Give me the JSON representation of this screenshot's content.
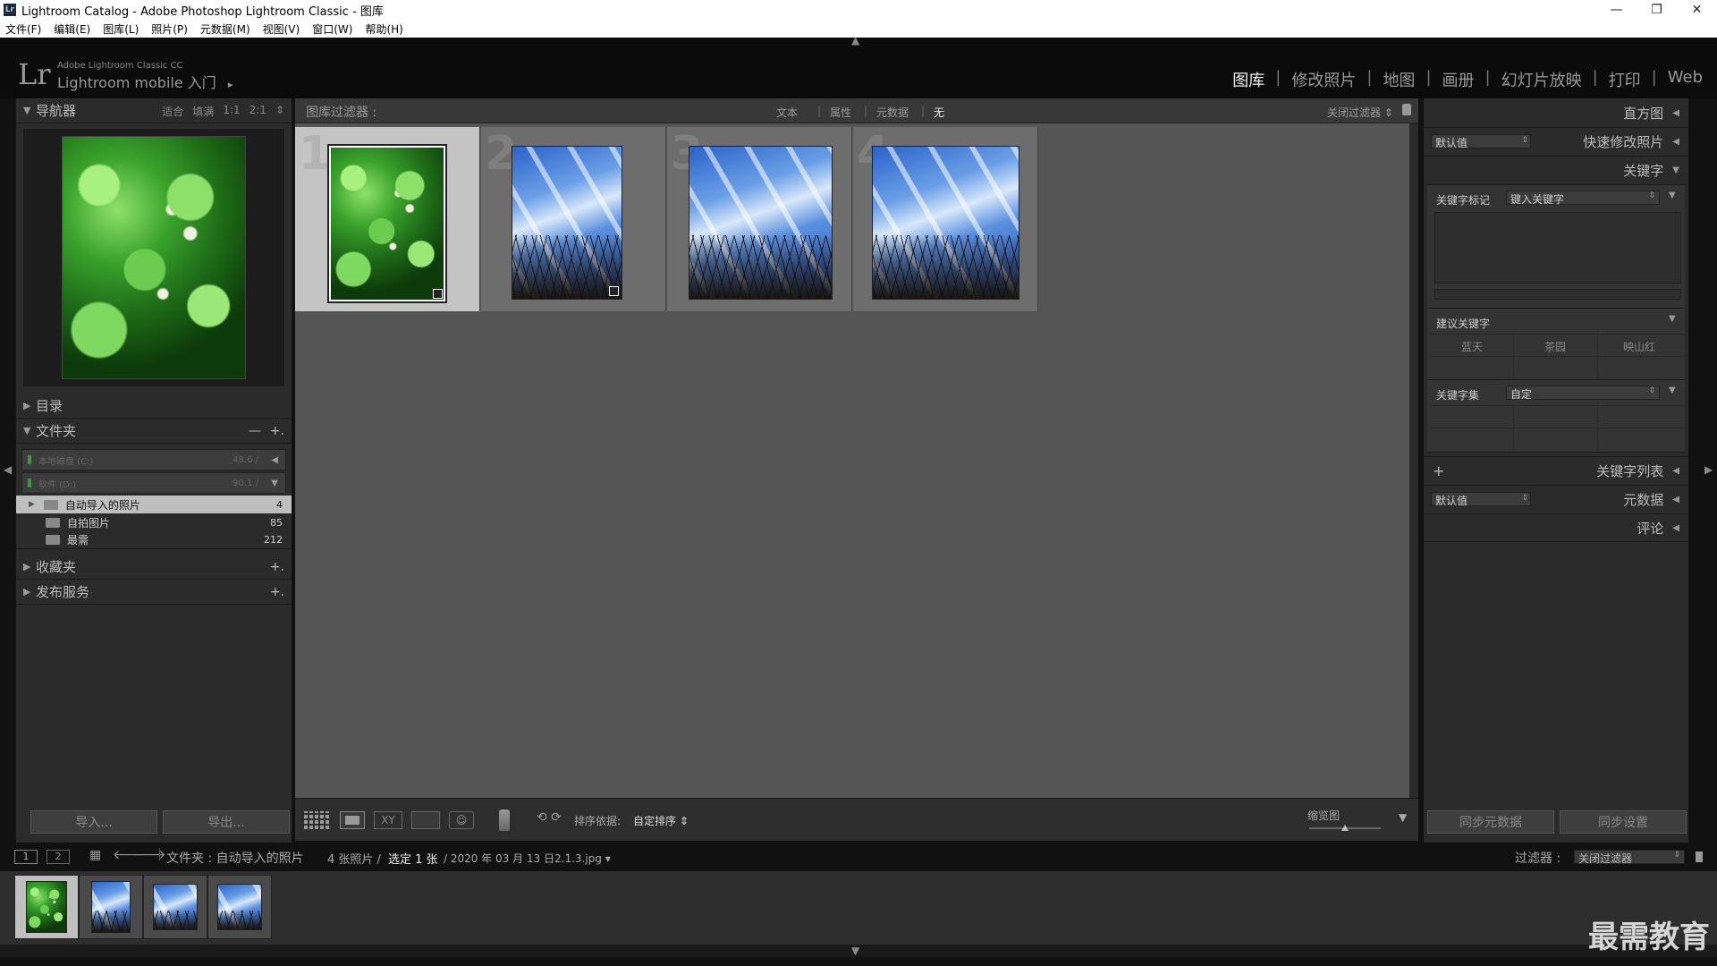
{
  "window": {
    "title": "Lightroom Catalog - Adobe Photoshop Lightroom Classic - 图库",
    "app_badge": "Lr",
    "controls": [
      "—",
      "❐",
      "✕"
    ]
  },
  "menu": [
    "文件(F)",
    "编辑(E)",
    "图库(L)",
    "照片(P)",
    "元数据(M)",
    "视图(V)",
    "窗口(W)",
    "帮助(H)"
  ],
  "identity": {
    "logo": "Lr",
    "line1": "Adobe Lightroom Classic CC",
    "line2": "Lightroom mobile 入门",
    "arrow": "▸"
  },
  "modules": {
    "items": [
      "图库",
      "修改照片",
      "地图",
      "画册",
      "幻灯片放映",
      "打印",
      "Web"
    ],
    "active": "图库",
    "sep": "|"
  },
  "left": {
    "navigator": {
      "title": "导航器",
      "options": [
        "适合",
        "填满",
        "1:1",
        "2:1"
      ],
      "spin": "⇕"
    },
    "catalog": {
      "title": "目录"
    },
    "folders": {
      "title": "文件夹",
      "minus": "—",
      "plus": "+.",
      "volumes": [
        {
          "name": "本地磁盘 (C:)",
          "cap": "48.6 /",
          "arrow": "◀"
        },
        {
          "name": "软件 (D:)",
          "cap": "90.1 /",
          "arrow": "▼"
        }
      ],
      "items": [
        {
          "name": "自动导入的照片",
          "count": "4",
          "selected": true
        },
        {
          "name": "自拍图片",
          "count": "85",
          "selected": false
        },
        {
          "name": "最需",
          "count": "212",
          "selected": false
        }
      ]
    },
    "collections": {
      "title": "收藏夹",
      "plus": "+."
    },
    "publish": {
      "title": "发布服务",
      "plus": "+."
    },
    "import_label": "导入...",
    "export_label": "导出..."
  },
  "filter_bar": {
    "title": "图库过滤器 :",
    "tabs": [
      "文本",
      "属性",
      "元数据",
      "无"
    ],
    "active_tab": "无",
    "close": "关闭过滤器 ⇕"
  },
  "grid": {
    "cells": [
      {
        "index": "1",
        "image": "clover",
        "selected": true,
        "badge": true
      },
      {
        "index": "2",
        "image": "sky",
        "selected": false,
        "badge": true
      },
      {
        "index": "3",
        "image": "sky",
        "selected": false,
        "badge": false
      },
      {
        "index": "4",
        "image": "sky",
        "selected": false,
        "badge": false
      }
    ]
  },
  "toolbar": {
    "sort_label": "排序依据:",
    "sort_value": "自定排序 ⇕",
    "thumb_label": "缩览图",
    "rotate": "⟲ ⟳"
  },
  "right": {
    "histogram": {
      "title": "直方图",
      "tri": "◀"
    },
    "quick_develop": {
      "title": "快速修改照片",
      "preset": "默认值",
      "tri": "◀"
    },
    "keywording": {
      "title": "关键字",
      "tri": "▼",
      "tags_label": "关键字标记",
      "tags_value": "键入关键字",
      "suggested_label": "建议关键字",
      "suggested": [
        "蓝天",
        "茶园",
        "映山红"
      ],
      "set_label": "关键字集",
      "set_value": "自定"
    },
    "keyword_list": {
      "title": "关键字列表",
      "plus": "+",
      "tri": "◀"
    },
    "metadata": {
      "title": "元数据",
      "preset": "默认值",
      "tri": "◀"
    },
    "comments": {
      "title": "评论",
      "tri": "◀"
    },
    "sync_metadata": "同步元数据",
    "sync_settings": "同步设置"
  },
  "filmstrip_bar": {
    "page1": "1",
    "page2": "2",
    "path": "文件夹 : 自动导入的照片",
    "count": "4 张照片 /",
    "selected": "选定 1 张",
    "file": "/ 2020 年 03 月 13 日2.1.3.jpg ▾",
    "filter_label": "过滤器 :",
    "filter_value": "关闭过滤器"
  },
  "filmstrip": {
    "thumbs": [
      "clover",
      "sky",
      "sky",
      "sky"
    ]
  },
  "watermark": "最需教育"
}
